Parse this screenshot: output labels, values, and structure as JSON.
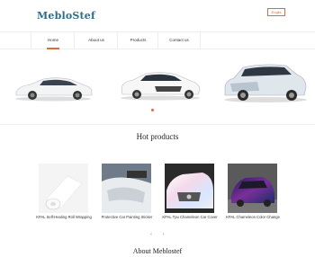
{
  "header": {
    "logo": "MebloStef",
    "language": "Englis"
  },
  "nav": {
    "items": [
      "Home",
      "About us",
      "Products",
      "Contact us"
    ],
    "active": "Home"
  },
  "hero": {
    "cars": [
      "white-tesla-sedan",
      "white-sedan",
      "silver-suv"
    ],
    "slide": 1
  },
  "hot_products": {
    "title": "Hot products",
    "items": [
      {
        "name": "KPAL Self-Healing Roll Wrapping"
      },
      {
        "name": "Protective Car Painting Sticker"
      },
      {
        "name": "KPAL Tpu Chameleon Car Cover"
      },
      {
        "name": "KPAL Chameleon Color Change"
      }
    ]
  },
  "carousel_controls": {
    "prev": "‹",
    "next": "›"
  },
  "about": {
    "title": "About Meblostef"
  },
  "colors": {
    "accent": "#e06a3a",
    "logo": "#2a6f8c"
  }
}
